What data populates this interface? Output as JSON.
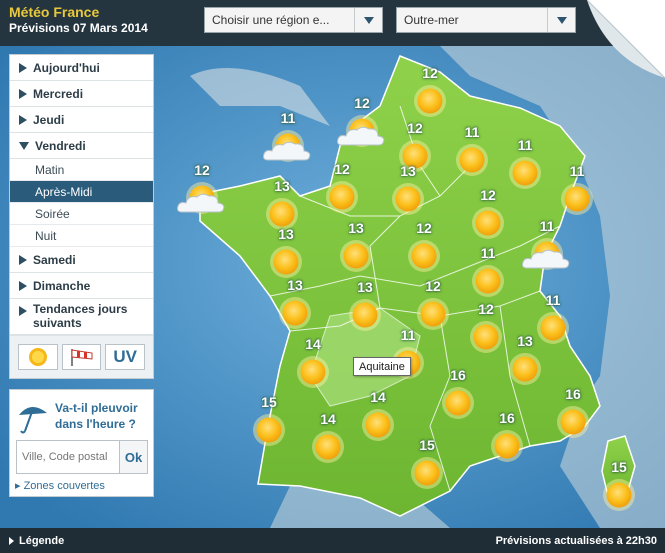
{
  "header": {
    "brand_title": "Météo France",
    "brand_subtitle": "Prévisions 07 Mars 2014",
    "region_select": "Choisir une région e...",
    "outremer_select": "Outre-mer"
  },
  "nav": {
    "days": [
      {
        "label": "Aujourd'hui"
      },
      {
        "label": "Mercredi"
      },
      {
        "label": "Jeudi"
      },
      {
        "label": "Vendredi"
      }
    ],
    "periods": [
      {
        "label": "Matin"
      },
      {
        "label": "Après-Midi"
      },
      {
        "label": "Soirée"
      },
      {
        "label": "Nuit"
      }
    ],
    "more_days": [
      {
        "label": "Samedi"
      },
      {
        "label": "Dimanche"
      },
      {
        "label": "Tendances jours suivants"
      }
    ],
    "active_day": "Vendredi",
    "active_period": "Après-Midi",
    "mode_uv_label": "UV"
  },
  "rain": {
    "question": "Va-t-il pleuvoir dans l'heure ?",
    "input_placeholder": "Ville, Code postal",
    "ok_label": "Ok",
    "zones_link": "Zones couvertes"
  },
  "tooltip": "Aquitaine",
  "footer": {
    "legend": "Légende",
    "updated": "Prévisions actualisées à 22h30"
  },
  "forecast": [
    {
      "temp": "12",
      "icon": "sun-icon"
    },
    {
      "temp": "12",
      "icon": "sun-cloud-icon"
    },
    {
      "temp": "11",
      "icon": "sun-cloud-icon"
    },
    {
      "temp": "12",
      "icon": "sun-icon"
    },
    {
      "temp": "11",
      "icon": "sun-icon"
    },
    {
      "temp": "11",
      "icon": "sun-icon"
    },
    {
      "temp": "12",
      "icon": "sun-cloud-icon"
    },
    {
      "temp": "13",
      "icon": "sun-icon"
    },
    {
      "temp": "12",
      "icon": "sun-icon"
    },
    {
      "temp": "13",
      "icon": "sun-icon"
    },
    {
      "temp": "11",
      "icon": "sun-icon"
    },
    {
      "temp": "12",
      "icon": "sun-icon"
    },
    {
      "temp": "13",
      "icon": "sun-icon"
    },
    {
      "temp": "13",
      "icon": "sun-icon"
    },
    {
      "temp": "12",
      "icon": "sun-icon"
    },
    {
      "temp": "11",
      "icon": "sun-icon"
    },
    {
      "temp": "11",
      "icon": "sun-cloud-icon"
    },
    {
      "temp": "13",
      "icon": "sun-icon"
    },
    {
      "temp": "13",
      "icon": "sun-icon"
    },
    {
      "temp": "12",
      "icon": "sun-icon"
    },
    {
      "temp": "12",
      "icon": "sun-icon"
    },
    {
      "temp": "11",
      "icon": "sun-icon"
    },
    {
      "temp": "14",
      "icon": "sun-icon"
    },
    {
      "temp": "11",
      "icon": "sun-icon"
    },
    {
      "temp": "13",
      "icon": "sun-icon"
    },
    {
      "temp": "15",
      "icon": "sun-icon"
    },
    {
      "temp": "14",
      "icon": "sun-icon"
    },
    {
      "temp": "14",
      "icon": "sun-icon"
    },
    {
      "temp": "16",
      "icon": "sun-icon"
    },
    {
      "temp": "16",
      "icon": "sun-icon"
    },
    {
      "temp": "15",
      "icon": "sun-icon"
    },
    {
      "temp": "16",
      "icon": "sun-icon"
    },
    {
      "temp": "15",
      "icon": "sun-icon"
    }
  ],
  "colors": {
    "land": "#7cc43a",
    "sea": "#4a90c4",
    "header": "#243540",
    "brand": "#e9c93a",
    "active": "#2b5b7a"
  }
}
